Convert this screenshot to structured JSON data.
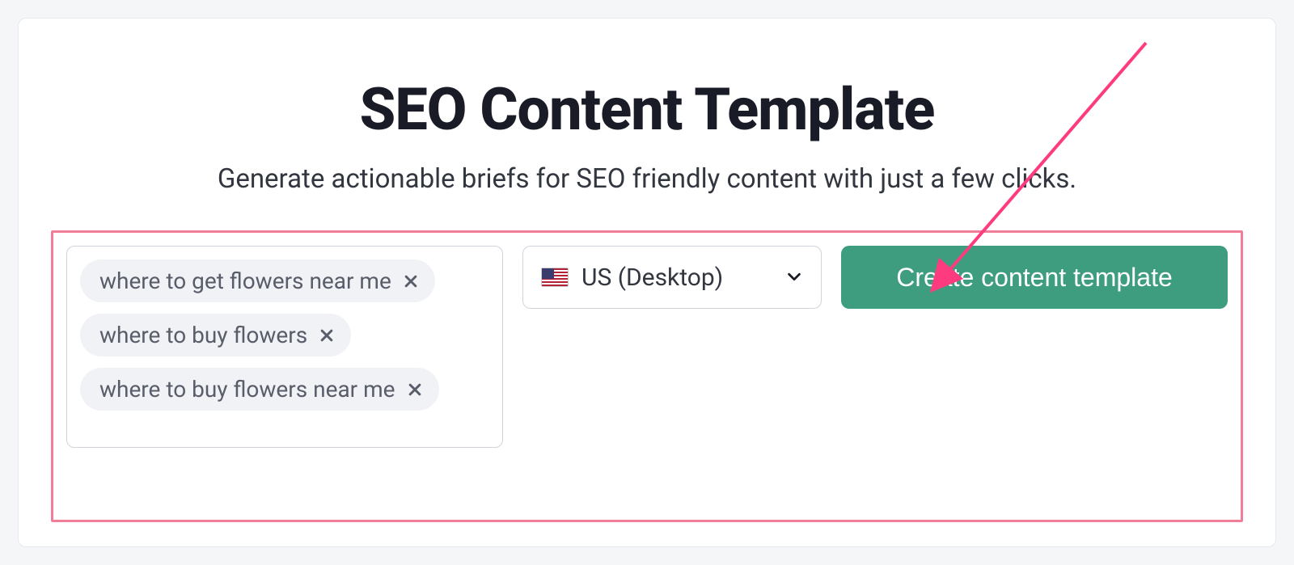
{
  "title": "SEO Content Template",
  "subtitle": "Generate actionable briefs for SEO friendly content with just a few clicks.",
  "keywords": [
    "where to get flowers near me",
    "where to buy flowers",
    "where to buy flowers near me"
  ],
  "locale": {
    "flag": "us",
    "label": "US (Desktop)"
  },
  "cta_label": "Create content template"
}
